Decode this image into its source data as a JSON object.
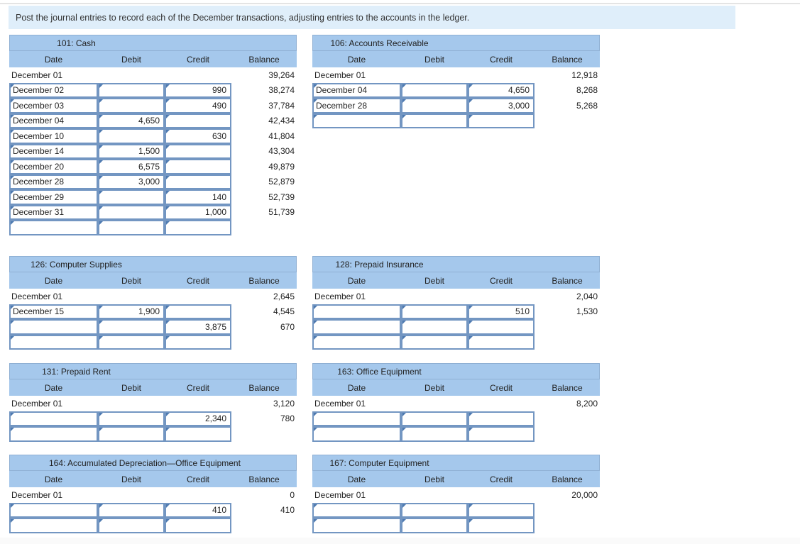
{
  "instruction": "Post the journal entries to record each of the December transactions, adjusting entries to the accounts in the ledger.",
  "ledgers": [
    {
      "title": "101: Cash",
      "headers": {
        "date": "Date",
        "debit": "Debit",
        "credit": "Credit",
        "balance": "Balance"
      },
      "rows": [
        {
          "date": "December 01",
          "debit": "",
          "credit": "",
          "balance": "39,264"
        },
        {
          "date": "December 02",
          "debit": "",
          "credit": "990",
          "balance": "38,274"
        },
        {
          "date": "December 03",
          "debit": "",
          "credit": "490",
          "balance": "37,784"
        },
        {
          "date": "December 04",
          "debit": "4,650",
          "credit": "",
          "balance": "42,434"
        },
        {
          "date": "December 10",
          "debit": "",
          "credit": "630",
          "balance": "41,804"
        },
        {
          "date": "December 14",
          "debit": "1,500",
          "credit": "",
          "balance": "43,304"
        },
        {
          "date": "December 20",
          "debit": "6,575",
          "credit": "",
          "balance": "49,879"
        },
        {
          "date": "December 28",
          "debit": "3,000",
          "credit": "",
          "balance": "52,879"
        },
        {
          "date": "December 29",
          "debit": "",
          "credit": "140",
          "balance": "52,739"
        },
        {
          "date": "December 31",
          "debit": "",
          "credit": "1,000",
          "balance": "51,739"
        },
        {
          "date": "",
          "debit": "",
          "credit": "",
          "balance": ""
        }
      ]
    },
    {
      "title": "106: Accounts Receivable",
      "headers": {
        "date": "Date",
        "debit": "Debit",
        "credit": "Credit",
        "balance": "Balance"
      },
      "rows": [
        {
          "date": "December 01",
          "debit": "",
          "credit": "",
          "balance": "12,918"
        },
        {
          "date": "December 04",
          "debit": "",
          "credit": "4,650",
          "balance": "8,268"
        },
        {
          "date": "December 28",
          "debit": "",
          "credit": "3,000",
          "balance": "5,268"
        },
        {
          "date": "",
          "debit": "",
          "credit": "",
          "balance": ""
        }
      ]
    },
    {
      "title": "126: Computer Supplies",
      "headers": {
        "date": "Date",
        "debit": "Debit",
        "credit": "Credit",
        "balance": "Balance"
      },
      "rows": [
        {
          "date": "December 01",
          "debit": "",
          "credit": "",
          "balance": "2,645"
        },
        {
          "date": "December 15",
          "debit": "1,900",
          "credit": "",
          "balance": "4,545"
        },
        {
          "date": "",
          "debit": "",
          "credit": "3,875",
          "balance": "670"
        },
        {
          "date": "",
          "debit": "",
          "credit": "",
          "balance": ""
        }
      ]
    },
    {
      "title": "128: Prepaid Insurance",
      "headers": {
        "date": "Date",
        "debit": "Debit",
        "credit": "Credit",
        "balance": "Balance"
      },
      "rows": [
        {
          "date": "December 01",
          "debit": "",
          "credit": "",
          "balance": "2,040"
        },
        {
          "date": "",
          "debit": "",
          "credit": "510",
          "balance": "1,530"
        },
        {
          "date": "",
          "debit": "",
          "credit": "",
          "balance": ""
        },
        {
          "date": "",
          "debit": "",
          "credit": "",
          "balance": ""
        }
      ]
    },
    {
      "title": "131: Prepaid Rent",
      "headers": {
        "date": "Date",
        "debit": "Debit",
        "credit": "Credit",
        "balance": "Balance"
      },
      "rows": [
        {
          "date": "December 01",
          "debit": "",
          "credit": "",
          "balance": "3,120"
        },
        {
          "date": "",
          "debit": "",
          "credit": "2,340",
          "balance": "780"
        },
        {
          "date": "",
          "debit": "",
          "credit": "",
          "balance": ""
        }
      ]
    },
    {
      "title": "163: Office Equipment",
      "headers": {
        "date": "Date",
        "debit": "Debit",
        "credit": "Credit",
        "balance": "Balance"
      },
      "rows": [
        {
          "date": "December 01",
          "debit": "",
          "credit": "",
          "balance": "8,200"
        },
        {
          "date": "",
          "debit": "",
          "credit": "",
          "balance": ""
        },
        {
          "date": "",
          "debit": "",
          "credit": "",
          "balance": ""
        }
      ]
    },
    {
      "title": "164: Accumulated Depreciation—Office Equipment",
      "headers": {
        "date": "Date",
        "debit": "Debit",
        "credit": "Credit",
        "balance": "Balance"
      },
      "rows": [
        {
          "date": "December 01",
          "debit": "",
          "credit": "",
          "balance": "0"
        },
        {
          "date": "",
          "debit": "",
          "credit": "410",
          "balance": "410"
        },
        {
          "date": "",
          "debit": "",
          "credit": "",
          "balance": ""
        }
      ]
    },
    {
      "title": "167: Computer Equipment",
      "headers": {
        "date": "Date",
        "debit": "Debit",
        "credit": "Credit",
        "balance": "Balance"
      },
      "rows": [
        {
          "date": "December 01",
          "debit": "",
          "credit": "",
          "balance": "20,000"
        },
        {
          "date": "",
          "debit": "",
          "credit": "",
          "balance": ""
        },
        {
          "date": "",
          "debit": "",
          "credit": "",
          "balance": ""
        }
      ]
    }
  ]
}
